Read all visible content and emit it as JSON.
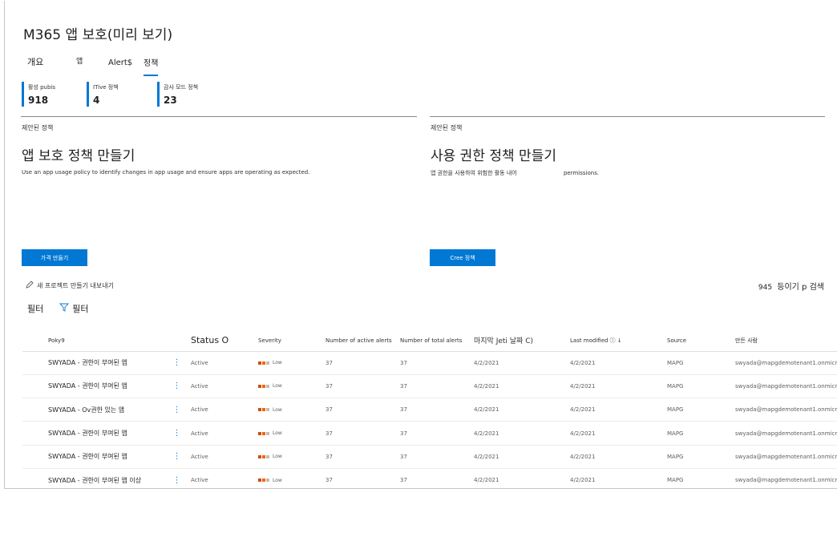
{
  "page": {
    "title": "M365 앱 보호(미리 보기)"
  },
  "tabs": [
    {
      "label": "개요"
    },
    {
      "label": "앱"
    },
    {
      "label": "Alert$"
    },
    {
      "label": "정책",
      "selected": true
    }
  ],
  "stats": [
    {
      "label": "활성 pubis",
      "value": "918"
    },
    {
      "label": "ITive 정책",
      "value": "4"
    },
    {
      "label": "감사 모드 정책",
      "value": "23"
    }
  ],
  "cards": [
    {
      "label": "제안된 정책",
      "title": "앱 보호 정책 만들기",
      "description": "Use an app usage policy to identify changes in app usage and ensure apps are operating as expected.",
      "button": "가격 만들기"
    },
    {
      "label": "제안된 정책",
      "title": "사용 권한 정책 만들기",
      "description": "앱 권한을 사용하여 위험한 활동 내어",
      "description_tail": "permissions.",
      "button": "Cree 정책"
    }
  ],
  "commands": {
    "new_policy": "새 프로젝트 만들기 내보내기"
  },
  "search": {
    "count": "945",
    "label": "등이기 p 검색"
  },
  "filter": {
    "label1": "필터",
    "label2": "필터"
  },
  "table": {
    "columns": [
      "Poky9",
      "",
      "Status O",
      "Severity",
      "Number of active alerts",
      "Number of total alerts",
      "마지막 Jeti 날짜 C)",
      "Last modified ⓘ ↓",
      "Source",
      "만든 사람"
    ],
    "rows": [
      {
        "name": "SWYADA - 권한이 부여된 앱",
        "status": "Active",
        "severity": "Low",
        "active": "37",
        "total": "37",
        "last_alert": "4/2/2021",
        "modified": "4/2/2021",
        "source": "MAPG",
        "creator": "swyada@mapgdemotenant1.onmicr"
      },
      {
        "name": "SWYADA - 권한이 부여된 앱",
        "status": "Active",
        "severity": "Low",
        "active": "37",
        "total": "37",
        "last_alert": "4/2/2021",
        "modified": "4/2/2021",
        "source": "MAPG",
        "creator": "swyada@mapgdemotenant1.onmicr"
      },
      {
        "name": "SWYADA - Ov권한 있는 앱",
        "status": "Active",
        "severity": "Low",
        "active": "37",
        "total": "37",
        "last_alert": "4/2/2021",
        "modified": "4/2/2021",
        "source": "MAPG",
        "creator": "swyada@mapgdemotenant1.onmicr"
      },
      {
        "name": "SWYADA - 권한이 부여된 앱",
        "status": "Active",
        "severity": "Low",
        "active": "37",
        "total": "37",
        "last_alert": "4/2/2021",
        "modified": "4/2/2021",
        "source": "MAPG",
        "creator": "swyada@mapgdemotenant1.onmicr"
      },
      {
        "name": "SWYADA - 권한이 부여된 앱",
        "status": "Active",
        "severity": "Low",
        "active": "37",
        "total": "37",
        "last_alert": "4/2/2021",
        "modified": "4/2/2021",
        "source": "MAPG",
        "creator": "swyada@mapgdemotenant1.onmicr"
      },
      {
        "name": "SWYADA - 권한이 부여된 앱 이상",
        "status": "Active",
        "severity": "Low",
        "active": "37",
        "total": "37",
        "last_alert": "4/2/2021",
        "modified": "4/2/2021",
        "source": "MAPG",
        "creator": "swyada@mapgdemotenant1.onmicr"
      }
    ]
  },
  "colors": {
    "accent": "#0078d4",
    "severity_low": "#ca5010"
  },
  "icons": {
    "edit": "pencil-icon",
    "filter": "funnel-icon",
    "row_menu": "more-vertical-icon"
  }
}
